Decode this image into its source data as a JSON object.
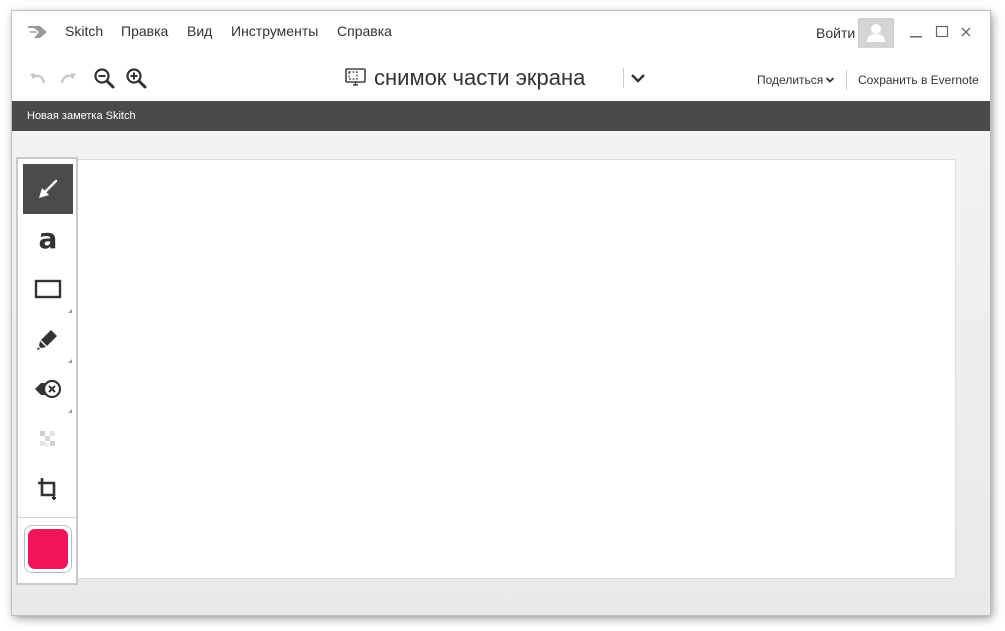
{
  "app": {
    "name": "Skitch"
  },
  "menu": {
    "items": [
      {
        "id": "skitch",
        "label": "Skitch"
      },
      {
        "id": "edit",
        "label": "Правка"
      },
      {
        "id": "view",
        "label": "Вид"
      },
      {
        "id": "tools",
        "label": "Инструменты"
      },
      {
        "id": "help",
        "label": "Справка"
      }
    ],
    "login_label": "Войти"
  },
  "toolbar": {
    "document_title": "снимок части экрана",
    "share_label": "Поделиться",
    "save_label": "Сохранить в Evernote"
  },
  "note": {
    "title": "Новая заметка Skitch"
  },
  "tools": [
    {
      "id": "arrow",
      "icon": "arrow-icon",
      "active": true
    },
    {
      "id": "text",
      "icon": "text-icon",
      "glyph": "a"
    },
    {
      "id": "rectangle",
      "icon": "rectangle-icon"
    },
    {
      "id": "marker",
      "icon": "marker-icon"
    },
    {
      "id": "stamp",
      "icon": "stamp-icon"
    },
    {
      "id": "pixelate",
      "icon": "pixelate-icon"
    },
    {
      "id": "crop",
      "icon": "crop-icon"
    }
  ],
  "colors": {
    "current": "#f0145a",
    "accent_dark": "#4b4b4b"
  }
}
